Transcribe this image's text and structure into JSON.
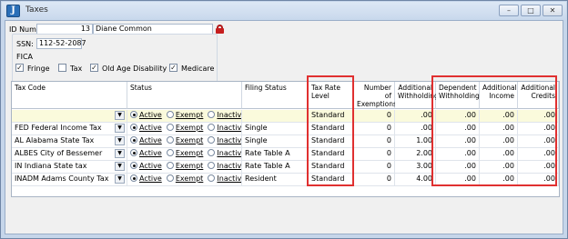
{
  "window": {
    "title": "Taxes"
  },
  "header": {
    "id_label": "ID Num :",
    "id_value": "13",
    "name_value": "Diane Common",
    "ssn_label": "SSN:",
    "ssn_value": "112-52-2087",
    "fica_label": "FICA",
    "fica": [
      {
        "label": "Fringe",
        "checked": true
      },
      {
        "label": "Tax",
        "checked": false
      },
      {
        "label": "Old Age Disability",
        "checked": true
      },
      {
        "label": "Medicare",
        "checked": true
      }
    ]
  },
  "grid": {
    "columns": {
      "tax_code": "Tax Code",
      "status": "Status",
      "filing_status": "Filing Status",
      "tax_rate_level": "Tax Rate Level",
      "exemptions": "Number of Exemptions",
      "additional_withholding": "Additional Withholding",
      "dependent_withholding": "Dependent Withholding",
      "additional_income": "Additional Income",
      "additional_credits": "Additional Credits"
    },
    "status_options": [
      "Active",
      "Exempt",
      "Inactive"
    ],
    "new_row": {
      "tax_code": "",
      "status": "Active",
      "filing_status": "",
      "tax_rate_level": "Standard",
      "exemptions": "0",
      "additional_withholding": ".00",
      "dependent_withholding": ".00",
      "additional_income": ".00",
      "additional_credits": ".00"
    },
    "rows": [
      {
        "tax_code": "FED   Federal Income Tax",
        "status": "Active",
        "filing_status": "Single",
        "tax_rate_level": "Standard",
        "exemptions": "0",
        "additional_withholding": ".00",
        "dependent_withholding": ".00",
        "additional_income": ".00",
        "additional_credits": ".00"
      },
      {
        "tax_code": "AL   Alabama State Tax",
        "status": "Active",
        "filing_status": "Single",
        "tax_rate_level": "Standard",
        "exemptions": "0",
        "additional_withholding": "1.00",
        "dependent_withholding": ".00",
        "additional_income": ".00",
        "additional_credits": ".00"
      },
      {
        "tax_code": "ALBES   City of Bessemer",
        "status": "Active",
        "filing_status": "Rate Table A",
        "tax_rate_level": "Standard",
        "exemptions": "0",
        "additional_withholding": "2.00",
        "dependent_withholding": ".00",
        "additional_income": ".00",
        "additional_credits": ".00"
      },
      {
        "tax_code": "IN   Indiana State tax",
        "status": "Active",
        "filing_status": "Rate Table A",
        "tax_rate_level": "Standard",
        "exemptions": "0",
        "additional_withholding": "3.00",
        "dependent_withholding": ".00",
        "additional_income": ".00",
        "additional_credits": ".00"
      },
      {
        "tax_code": "INADM   Adams County Tax",
        "status": "Active",
        "filing_status": "Resident",
        "tax_rate_level": "Standard",
        "exemptions": "0",
        "additional_withholding": "4.00",
        "dependent_withholding": ".00",
        "additional_income": ".00",
        "additional_credits": ".00"
      }
    ]
  }
}
